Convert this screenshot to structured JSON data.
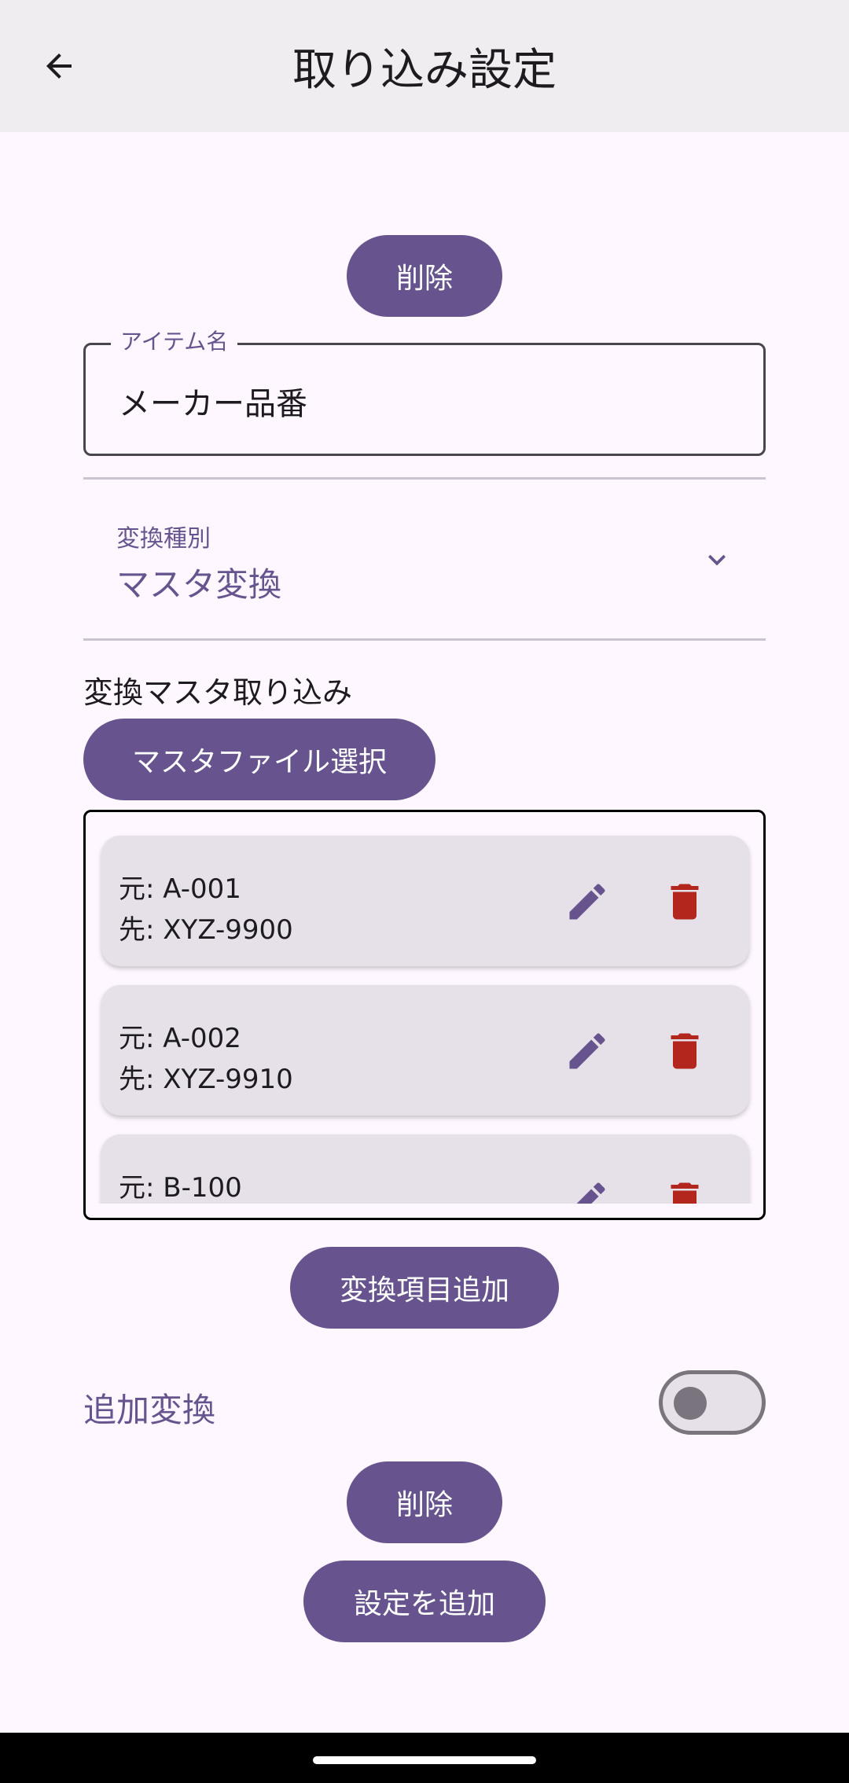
{
  "appbar": {
    "title": "取り込み設定",
    "back_icon": "arrow-back-icon"
  },
  "top_delete_button": "削除",
  "item_name_field": {
    "label": "アイテム名",
    "value": "メーカー品番"
  },
  "conversion_type": {
    "label": "変換種別",
    "value": "マスタ変換",
    "icon": "chevron-down-icon"
  },
  "master_import": {
    "title": "変換マスタ取り込み",
    "select_file_button": "マスタファイル選択"
  },
  "mappings": [
    {
      "source": "元: A-001",
      "target": "先: XYZ-9900"
    },
    {
      "source": "元: A-002",
      "target": "先: XYZ-9910"
    },
    {
      "source": "元: B-100",
      "target": ""
    }
  ],
  "add_mapping_button": "変換項目追加",
  "extra_conversion": {
    "label": "追加変換",
    "enabled": false
  },
  "bottom_delete_button": "削除",
  "add_setting_button": "設定を追加",
  "colors": {
    "primary": "#67548E",
    "background": "#FEF7FF",
    "appbar": "#F0EDF1",
    "card": "#E6E0E9",
    "danger": "#B3261E"
  }
}
